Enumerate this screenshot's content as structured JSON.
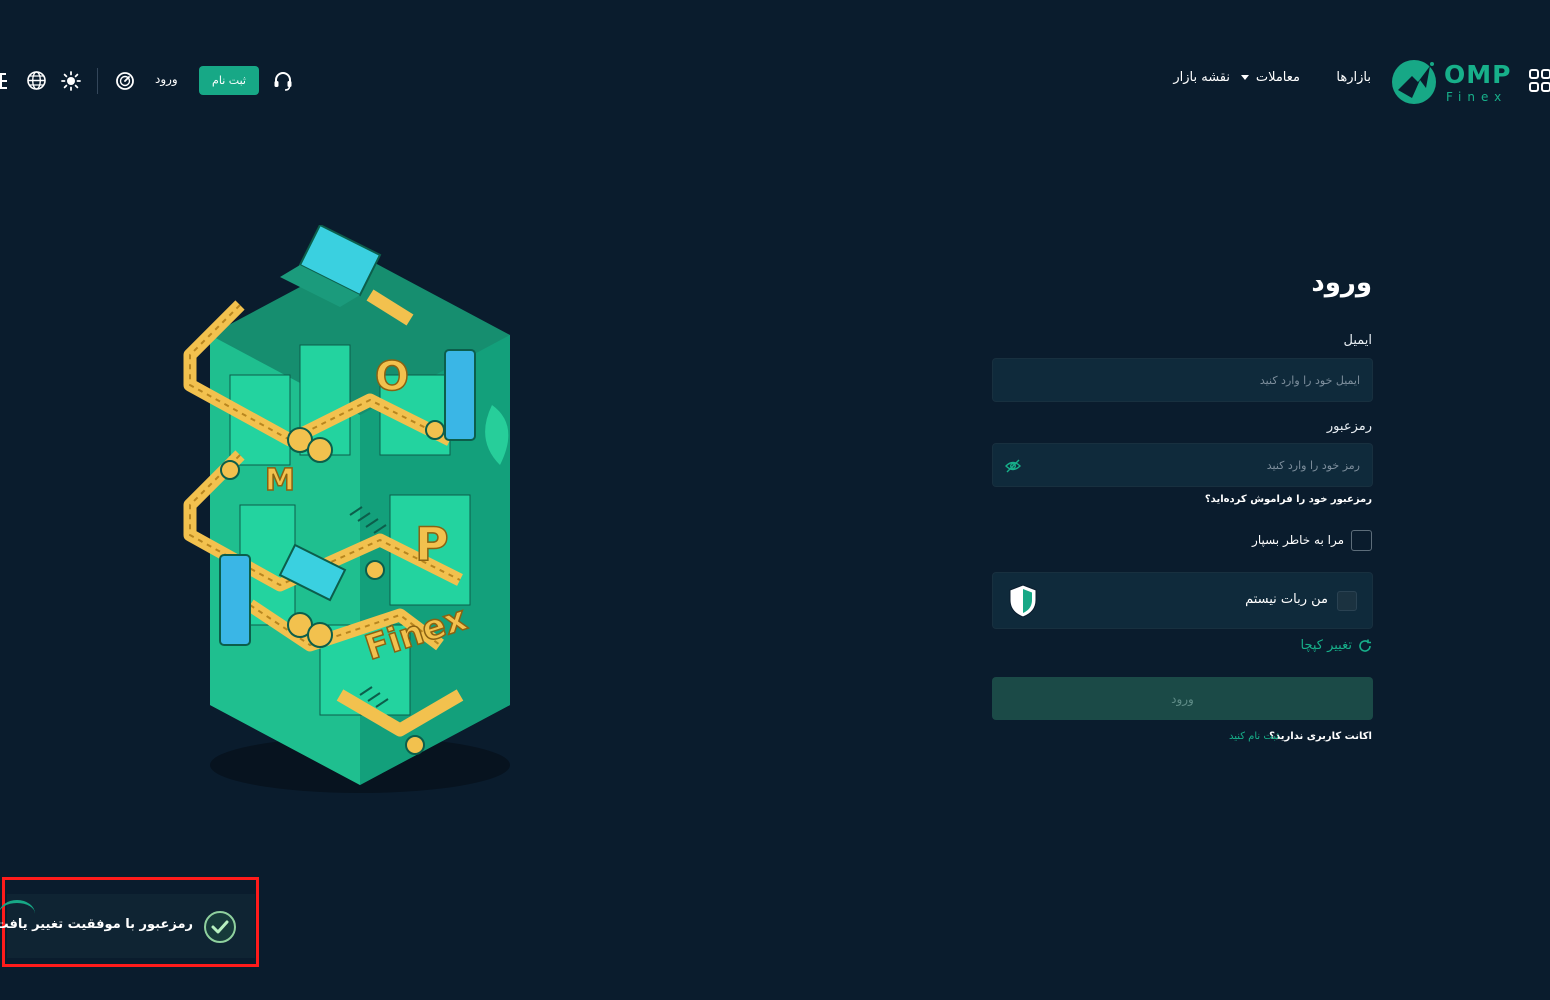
{
  "header": {
    "brand_name": "OMP",
    "brand_sub": "Finex",
    "nav": {
      "markets": "بازارها",
      "trades": "معاملات",
      "market_map": "نقشه بازار"
    },
    "signup_button": "ثبت نام",
    "login_link": "ورود"
  },
  "login": {
    "title": "ورود",
    "email_label": "ایمیل",
    "email_placeholder": "ایمیل خود را وارد کنید",
    "password_label": "رمزعبور",
    "password_placeholder": "رمز خود را وارد کنید",
    "forgot_link": "رمزعبور خود را فراموش کرده‌اید؟",
    "remember_me": "مرا به خاطر بسپار",
    "captcha_label": "من ربات نیستم",
    "change_captcha": "تغییر کپچا",
    "submit": "ورود",
    "no_account": "اکانت کاربری ندارید؟",
    "signup_link": "ثبت نام کنید"
  },
  "toast": {
    "message": "رمزعبور با موفقیت تغییر یافت"
  },
  "illustration": {
    "word_finex": "Finex",
    "letter_o": "O",
    "letter_p": "P",
    "letter_m": "M"
  },
  "colors": {
    "background": "#0a1c2d",
    "accent": "#17a886",
    "field_bg": "#0f2a3b",
    "illustration_green": "#1fbf8f",
    "illustration_yellow": "#f2c14e",
    "toast_highlight": "#ff1b1b"
  }
}
